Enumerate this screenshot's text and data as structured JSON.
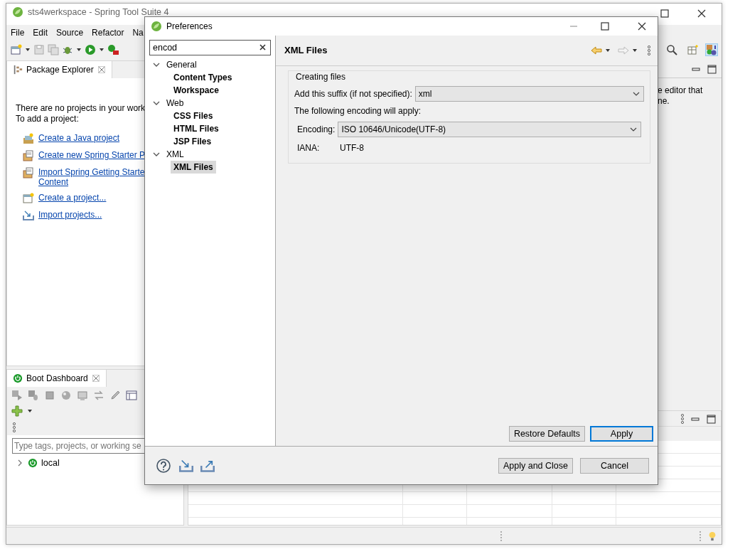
{
  "main_window": {
    "title": "sts4werkspace - Spring Tool Suite 4",
    "menu": [
      "File",
      "Edit",
      "Source",
      "Refactor",
      "Na"
    ],
    "package_explorer": {
      "tab": "Package Explorer",
      "message": [
        "There are no projects in your work",
        "To add a project:"
      ],
      "links": [
        {
          "kind": "java",
          "lines": [
            "Create a Java project"
          ]
        },
        {
          "kind": "spring",
          "lines": [
            "Create new Spring Starter P"
          ]
        },
        {
          "kind": "spring",
          "lines": [
            "Import Spring Getting Starte",
            "Content"
          ]
        },
        {
          "kind": "project",
          "lines": [
            "Create a project..."
          ]
        },
        {
          "kind": "import",
          "lines": [
            "Import projects..."
          ]
        }
      ]
    },
    "side_panel_text": [
      "e editor that",
      "ne."
    ],
    "boot_dashboard": {
      "tab": "Boot Dashboard",
      "filter_placeholder": "Type tags, projects, or working se",
      "tree": [
        {
          "label": "local",
          "expanded": false
        }
      ]
    }
  },
  "dialog": {
    "title": "Preferences",
    "filter_value": "encod",
    "tree": [
      {
        "label": "General",
        "expanded": true,
        "selected": false,
        "children": [
          {
            "label": "Content Types",
            "selected": false
          },
          {
            "label": "Workspace",
            "selected": false
          }
        ]
      },
      {
        "label": "Web",
        "expanded": true,
        "selected": false,
        "children": [
          {
            "label": "CSS Files",
            "selected": false
          },
          {
            "label": "HTML Files",
            "selected": false
          },
          {
            "label": "JSP Files",
            "selected": false
          }
        ]
      },
      {
        "label": "XML",
        "expanded": true,
        "selected": false,
        "children": [
          {
            "label": "XML Files",
            "selected": true
          }
        ]
      }
    ],
    "page_title": "XML Files",
    "group": {
      "title": "Creating files",
      "suffix_label": "Add this suffix (if not specified):",
      "suffix_value": "xml",
      "encoding_note": "The following encoding will apply:",
      "encoding_label": "Encoding:",
      "encoding_value": "ISO 10646/Unicode(UTF-8)",
      "iana_label": "IANA:",
      "iana_value": "UTF-8"
    },
    "page_buttons": [
      {
        "label": "Restore Defaults",
        "default": false
      },
      {
        "label": "Apply",
        "default": true
      }
    ],
    "footer_buttons": [
      {
        "label": "Apply and Close",
        "default": false
      },
      {
        "label": "Cancel",
        "default": false
      }
    ]
  }
}
